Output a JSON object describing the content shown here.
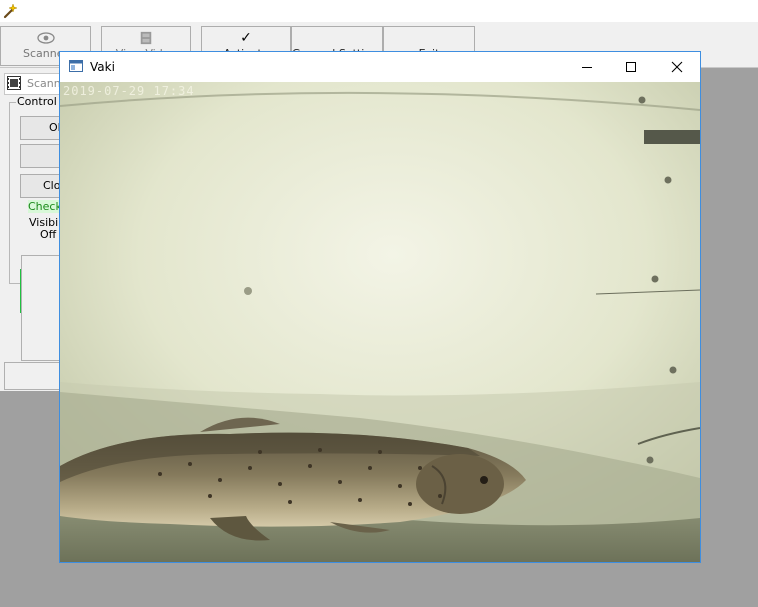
{
  "app": {
    "icon": "wand-icon"
  },
  "toolbar": {
    "buttons": [
      {
        "label": "Scanner",
        "icon": "eye-icon"
      },
      {
        "label": "View Video",
        "icon": "film-strip-icon"
      },
      {
        "label": "Activate",
        "icon": "checkmark-icon",
        "glyph": "✓"
      },
      {
        "label": "General Settings",
        "icon": ""
      },
      {
        "label": "Exit",
        "icon": ""
      }
    ]
  },
  "scanner_window": {
    "title": "Scanner",
    "group_title": "Control P",
    "buttons": {
      "open": "Ol",
      "blank": "",
      "close": "Clo"
    },
    "check_group": {
      "title": "Check",
      "visibility_label": "Visibili",
      "visibility_value": "Off"
    }
  },
  "video_window": {
    "title": "Vaki",
    "timestamp": "2019-07-29 17:34",
    "controls": {
      "minimize": "minimize-icon",
      "maximize": "maximize-icon",
      "close": "close-icon"
    }
  },
  "colors": {
    "window_border": "#3e8ee0",
    "check_border": "#20c040",
    "check_fill": "#d8f8d8",
    "desktop": "#a0a0a0"
  }
}
